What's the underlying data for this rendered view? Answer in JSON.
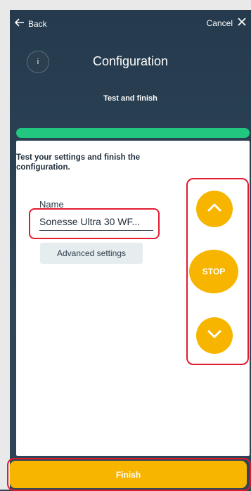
{
  "topbar": {
    "back_label": "Back",
    "cancel_label": "Cancel"
  },
  "header": {
    "info_glyph": "i",
    "title": "Configuration",
    "step_label": "Test and finish"
  },
  "progress": {
    "value": 1.0,
    "color": "#21c67f"
  },
  "content": {
    "instruction": "Test your settings and finish the configuration.",
    "name_label": "Name",
    "name_value": "Sonesse Ultra 30 WF...",
    "advanced_label": "Advanced settings"
  },
  "controls": {
    "up_icon": "chevron-up-icon",
    "stop_label": "STOP",
    "down_icon": "chevron-down-icon",
    "accent": "#f7b500"
  },
  "footer": {
    "finish_label": "Finish"
  },
  "colors": {
    "background": "#2f4456",
    "highlight": "#e21b2f",
    "accent": "#f7b500"
  }
}
